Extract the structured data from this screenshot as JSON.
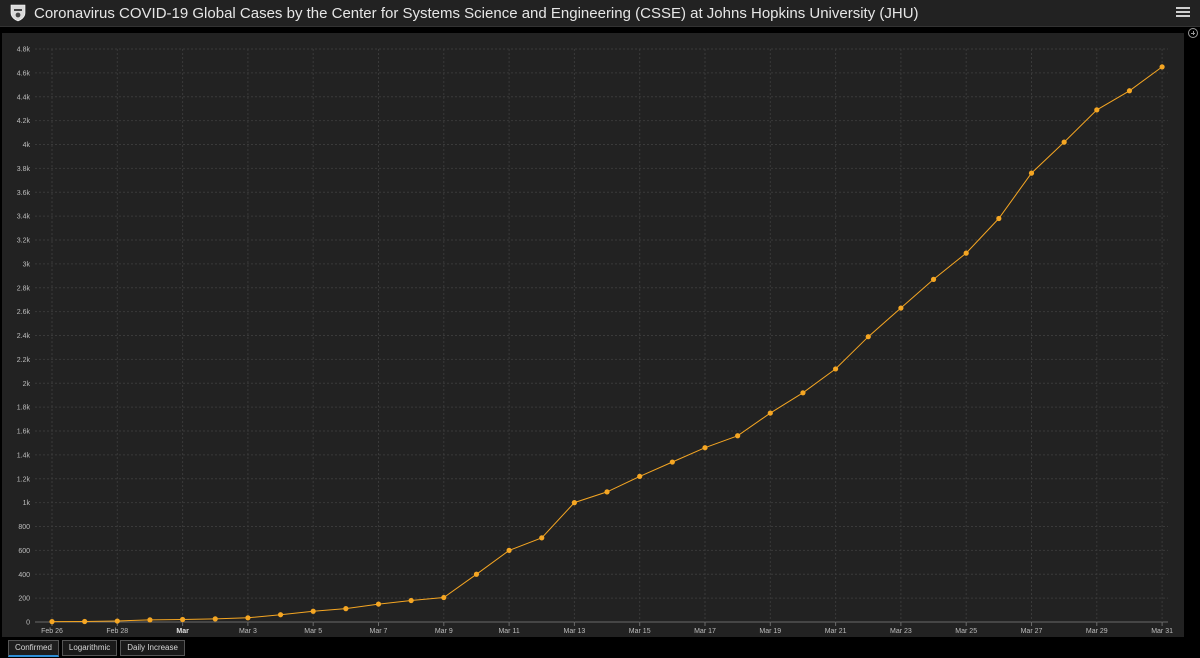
{
  "header": {
    "title": "Coronavirus COVID-19 Global Cases by the Center for Systems Science and Engineering (CSSE) at Johns Hopkins University (JHU)"
  },
  "tabs": [
    {
      "label": "Confirmed",
      "active": true
    },
    {
      "label": "Logarithmic",
      "active": false
    },
    {
      "label": "Daily Increase",
      "active": false
    }
  ],
  "colors": {
    "series": "#f5a623",
    "grid": "#3a3a3a",
    "panel": "#222222"
  },
  "chart_data": {
    "type": "line",
    "title": "",
    "xlabel": "",
    "ylabel": "",
    "ylim": [
      0,
      4800
    ],
    "y_ticks": [
      0,
      200,
      400,
      600,
      800,
      1000,
      1200,
      1400,
      1600,
      1800,
      2000,
      2200,
      2400,
      2600,
      2800,
      3000,
      3200,
      3400,
      3600,
      3800,
      4000,
      4200,
      4400,
      4600,
      4800
    ],
    "y_tick_labels": [
      "0",
      "200",
      "400",
      "600",
      "800",
      "1k",
      "1.2k",
      "1.4k",
      "1.6k",
      "1.8k",
      "2k",
      "2.2k",
      "2.4k",
      "2.6k",
      "2.8k",
      "3k",
      "3.2k",
      "3.4k",
      "3.6k",
      "3.8k",
      "4k",
      "4.2k",
      "4.4k",
      "4.6k",
      "4.8k"
    ],
    "x_tick_labels": [
      "Feb 26",
      "Feb 28",
      "Mar",
      "Mar 3",
      "Mar 5",
      "Mar 7",
      "Mar 9",
      "Mar 11",
      "Mar 13",
      "Mar 15",
      "Mar 17",
      "Mar 19",
      "Mar 21",
      "Mar 23",
      "Mar 25",
      "Mar 27",
      "Mar 29",
      "Mar 31"
    ],
    "x_tick_bold": [
      "Mar"
    ],
    "grid": true,
    "series": [
      {
        "x": [
          "Feb 26",
          "Feb 27",
          "Feb 28",
          "Feb 29",
          "Mar 1",
          "Mar 2",
          "Mar 3",
          "Mar 4",
          "Mar 5",
          "Mar 6",
          "Mar 7",
          "Mar 8",
          "Mar 9",
          "Mar 10",
          "Mar 11",
          "Mar 12",
          "Mar 13",
          "Mar 14",
          "Mar 15",
          "Mar 16",
          "Mar 17",
          "Mar 18",
          "Mar 19",
          "Mar 20",
          "Mar 21",
          "Mar 22",
          "Mar 23",
          "Mar 24",
          "Mar 25",
          "Mar 26",
          "Mar 27",
          "Mar 28",
          "Mar 29",
          "Mar 30",
          "Mar 31"
        ],
        "values": [
          3,
          4,
          8,
          18,
          21,
          26,
          35,
          61,
          90,
          112,
          150,
          180,
          205,
          400,
          600,
          705,
          1000,
          1090,
          1220,
          1340,
          1460,
          1560,
          1750,
          1920,
          2120,
          2390,
          2630,
          2870,
          3090,
          3380,
          3760,
          4020,
          4290,
          4450,
          4650
        ]
      }
    ]
  }
}
